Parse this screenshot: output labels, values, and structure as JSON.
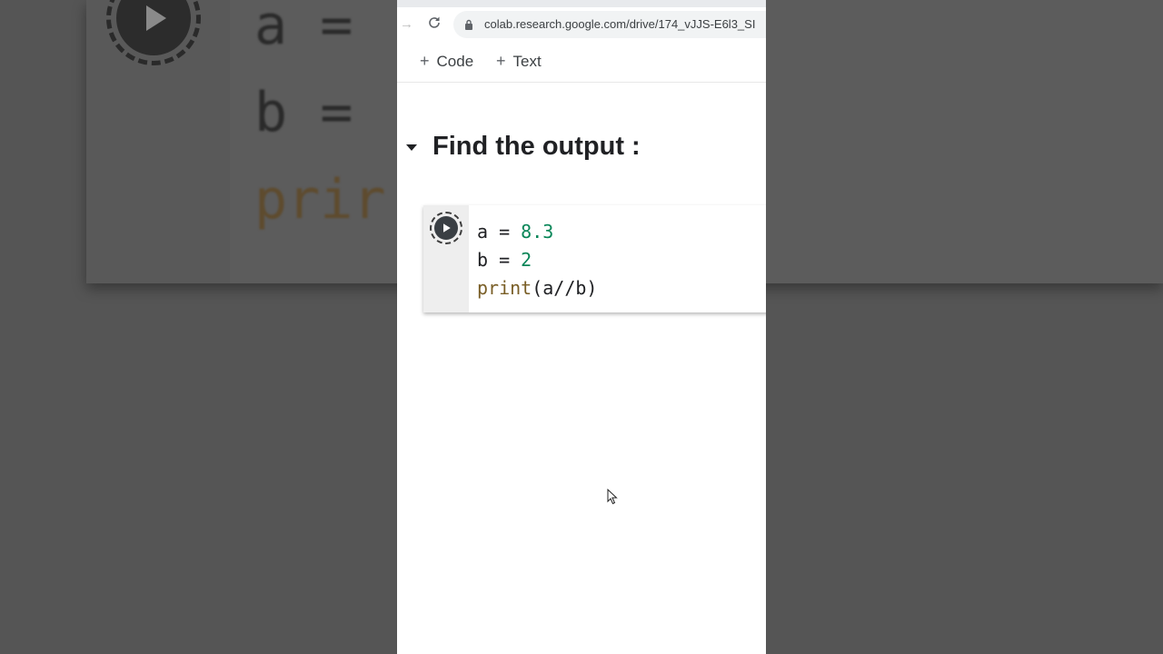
{
  "background": {
    "code_lines": [
      "a =",
      "b =",
      "prir"
    ]
  },
  "browser": {
    "url": "colab.research.google.com/drive/174_vJJS-E6l3_SI"
  },
  "toolbar": {
    "code_label": "Code",
    "text_label": "Text"
  },
  "section": {
    "title": "Find the output :"
  },
  "cell": {
    "line1_var": "a = ",
    "line1_num": "8.3",
    "line2_var": "b = ",
    "line2_num": "2",
    "line3_fn": "print",
    "line3_args": "(a//b)"
  },
  "colors": {
    "number": "#098658",
    "function": "#795e26"
  }
}
